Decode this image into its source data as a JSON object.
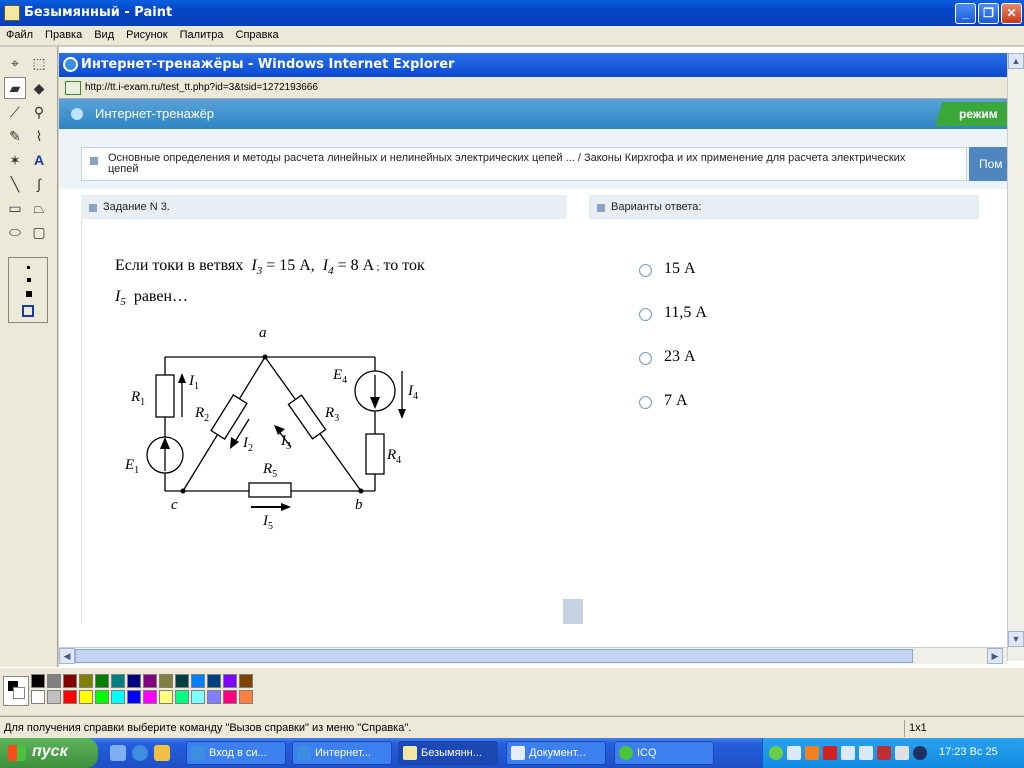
{
  "paint": {
    "title": "Безымянный - Paint",
    "menu": [
      "Файл",
      "Правка",
      "Вид",
      "Рисунок",
      "Палитра",
      "Справка"
    ],
    "status": "Для получения справки выберите команду \"Вызов справки\" из меню \"Справка\".",
    "size": "1x1",
    "palette": [
      "#000000",
      "#808080",
      "#800000",
      "#808000",
      "#008000",
      "#008080",
      "#000080",
      "#800080",
      "#808040",
      "#004040",
      "#0080ff",
      "#004080",
      "#8000ff",
      "#804000",
      "#ffffff",
      "#c0c0c0",
      "#ff0000",
      "#ffff00",
      "#00ff00",
      "#00ffff",
      "#0000ff",
      "#ff00ff",
      "#ffff80",
      "#00ff80",
      "#80ffff",
      "#8080ff",
      "#ff0080",
      "#ff8040"
    ]
  },
  "ie": {
    "title": "Интернет-тренажёры - Windows Internet Explorer",
    "url": "http://tt.i-exam.ru/test_tt.php?id=3&tsid=1272193666"
  },
  "site": {
    "name": "Интернет-тренажёр",
    "mode_label": "режим",
    "help_label": "Пом",
    "breadcrumb": "Основные определения и методы расчета линейных и нелинейных электрических цепей ... / Законы Кирхгофа и их применение для расчета электрических цепей",
    "task_tab": "Задание N 3.",
    "answers_tab": "Варианты ответа:",
    "question_line1": "Если токи в ветвях",
    "question_line2": "равен…",
    "answers": [
      "15 А",
      "11,5 А",
      "23 А",
      "7 А"
    ]
  },
  "taskbar": {
    "start": "пуск",
    "tasks": [
      "Вход в си...",
      "Интернет...",
      "Безымянн...",
      "Документ...",
      "ICQ"
    ],
    "clock": "17:23 Вс 25"
  }
}
